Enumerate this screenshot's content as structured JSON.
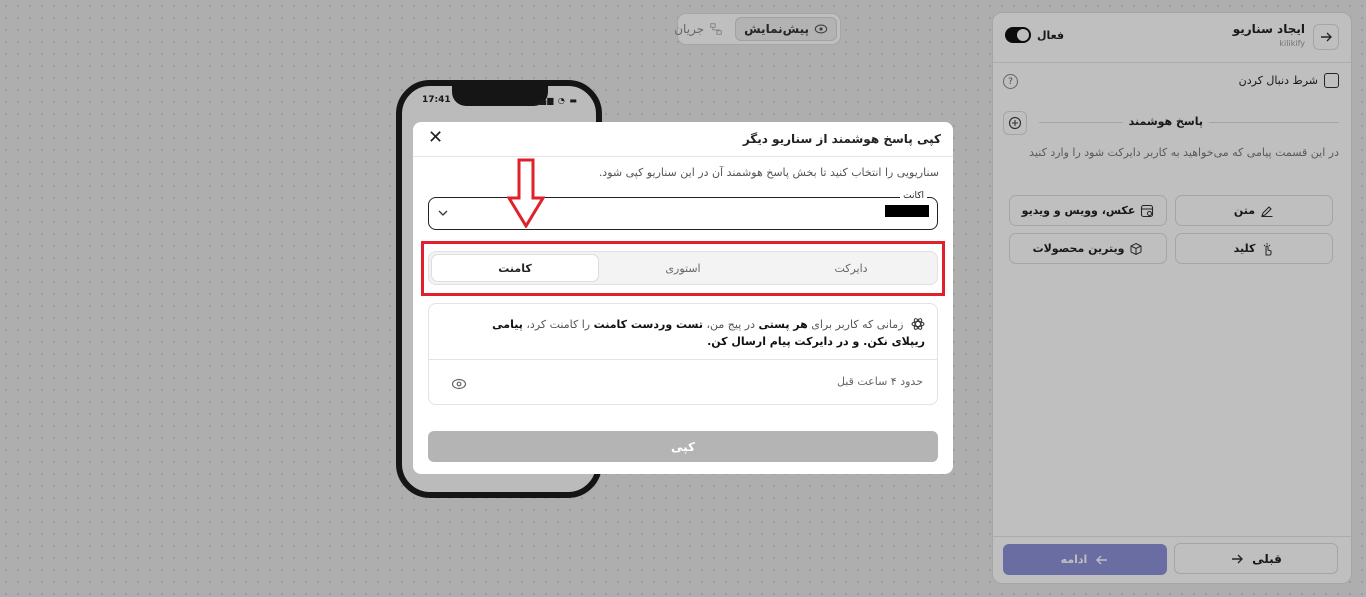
{
  "top_toggle": {
    "preview": "پیش‌نمایش",
    "flow": "جریان"
  },
  "phone": {
    "time": "17:41",
    "status": "▂▄▆ ◔ ▬"
  },
  "panel": {
    "title": "ایجاد سناریو",
    "subtitle": "kilikify",
    "active_label": "فعال",
    "follow_label": "شرط دنبال کردن",
    "help": "?",
    "smart_reply": "پاسخ هوشمند",
    "smart_desc": "در این قسمت پیامی که می‌خواهید به کاربر دایرکت شود را وارد کنید",
    "options": {
      "text": "متن",
      "media": "عکس، وویس و ویدیو",
      "key": "کلید",
      "showcase": "ویترین محصولات"
    },
    "prev": "قبلی",
    "next": "ادامه"
  },
  "modal": {
    "title": "کپی پاسخ هوشمند از سناریو دیگر",
    "close": "✕",
    "description": "سناریویی را انتخاب کنید تا بخش پاسخ هوشمند آن در این سناریو کپی شود.",
    "account_label": "اکانت",
    "tabs": [
      "دایرکت",
      "استوری",
      "کامنت"
    ],
    "active_tab": "کامنت",
    "card": {
      "p1": "زمانی که کاربر برای",
      "b1": "هر پستی",
      "p2": "در پیج من،",
      "b2": "تست وردست کامنت",
      "p3": "را کامنت کرد،",
      "b3": "پیامی ریپلای نکن. و در دایرکت پیام ارسال کن.",
      "time": "حدود ۴ ساعت قبل"
    },
    "copy_button": "کپی"
  },
  "colors": {
    "highlight": "#e0212b",
    "next_button": "#8e92d9",
    "copy_button": "#b4b4b4"
  }
}
